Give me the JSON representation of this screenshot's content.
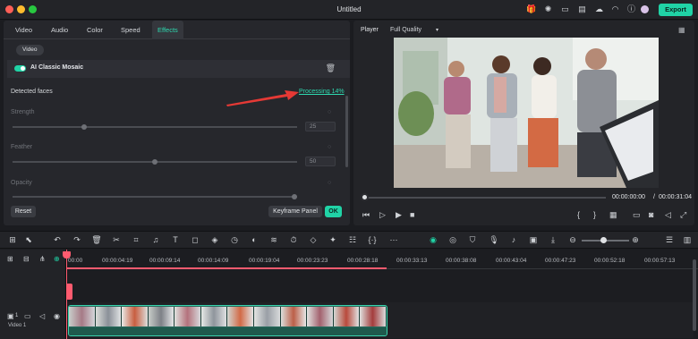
{
  "app": {
    "title": "Untitled",
    "export_label": "Export"
  },
  "colors": {
    "accent": "#20d3a6",
    "playhead": "#ff5b6f",
    "annotation_arrow": "#e53935"
  },
  "titlebar_icons": [
    "gift-icon",
    "sun-icon",
    "layout-icon",
    "save-icon",
    "cloud-icon",
    "headset-icon",
    "info-icon",
    "avatar"
  ],
  "left_panel": {
    "tabs": [
      "Video",
      "Audio",
      "Color",
      "Speed",
      "Effects"
    ],
    "active_tab": "Effects",
    "chip": "Video",
    "effect_name": "AI Classic Mosaic",
    "detected_faces_label": "Detected faces",
    "processing_label": "Processing 14%",
    "processing_progress_percent": 14,
    "sliders": [
      {
        "label": "Strength",
        "value": "25",
        "level_percent": 25
      },
      {
        "label": "Feather",
        "value": "50",
        "level_percent": 50
      },
      {
        "label": "Opacity",
        "value": "100",
        "level_percent": 100
      }
    ],
    "reset_label": "Reset",
    "keyframe_label": "Keyframe Panel",
    "ok_label": "OK"
  },
  "player": {
    "label": "Player",
    "quality": "Full Quality",
    "current_time": "00:00:00:00",
    "separator": "/",
    "total_time": "00:00:31:04"
  },
  "timeline": {
    "ruler": [
      "00:00",
      "00:00:04:19",
      "00:00:09:14",
      "00:00:14:09",
      "00:00:19:04",
      "00:00:23:23",
      "00:00:28:18",
      "00:00:33:13",
      "00:00:38:08",
      "00:00:43:04",
      "00:00:47:23",
      "00:00:52:18",
      "00:00:57:13"
    ],
    "track_label": "Video 1",
    "track_number": "1"
  }
}
